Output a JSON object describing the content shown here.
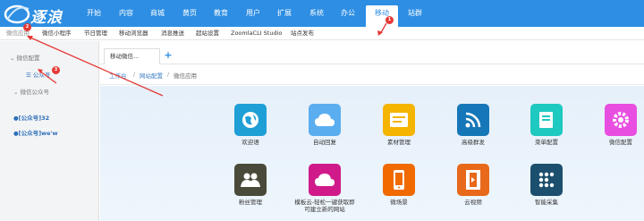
{
  "logo": {
    "text": "逐浪"
  },
  "topnav": {
    "items": [
      "开始",
      "内容",
      "商城",
      "黄页",
      "教育",
      "用户",
      "扩展",
      "系统",
      "办公",
      "移动",
      "站群"
    ],
    "active_index": 9
  },
  "subnav": {
    "items": [
      "微信应用",
      "微信小程序",
      "节日管理",
      "移动浏览器",
      "消息推送",
      "超站设置",
      "ZoomlaCLI Studio",
      "站点发布"
    ]
  },
  "sidebar": {
    "group1": "微信配置",
    "leaf1": "公众号",
    "group2": "微信公众号",
    "account1": "[公众号]32",
    "account2": "[公众号]we'w"
  },
  "tabs": {
    "current": "移动微信...",
    "add": "+"
  },
  "breadcrumb": {
    "items": [
      "工作台",
      "网站配置",
      "微信应用"
    ],
    "sep": "/"
  },
  "tiles": {
    "row1": [
      {
        "label": "欢迎语",
        "icon": "globe-icon",
        "color": "#1e9fd6"
      },
      {
        "label": "自动回复",
        "icon": "cloud-icon",
        "color": "#5aaef0"
      },
      {
        "label": "素材管理",
        "icon": "card-icon",
        "color": "#f5b400"
      },
      {
        "label": "高级群发",
        "icon": "rss-icon",
        "color": "#1677b8"
      },
      {
        "label": "菜单配置",
        "icon": "book-icon",
        "color": "#1ec9c0"
      },
      {
        "label": "微信配置",
        "icon": "gear-icon",
        "color": "#e84ee0"
      }
    ],
    "row2": [
      {
        "label": "粉丝管理",
        "icon": "users-icon",
        "color": "#4a4a3a"
      },
      {
        "label": "模板云-轻松一键获取即可建立新的网站",
        "icon": "cloud-icon",
        "color": "#d01a8a"
      },
      {
        "label": "微场景",
        "icon": "phone-icon",
        "color": "#f06a00"
      },
      {
        "label": "云视频",
        "icon": "film-icon",
        "color": "#e8691a"
      },
      {
        "label": "智能采集",
        "icon": "dots-icon",
        "color": "#1c4f6e"
      }
    ]
  },
  "badges": {
    "b1": "1",
    "b2": "2",
    "b3": "3"
  }
}
